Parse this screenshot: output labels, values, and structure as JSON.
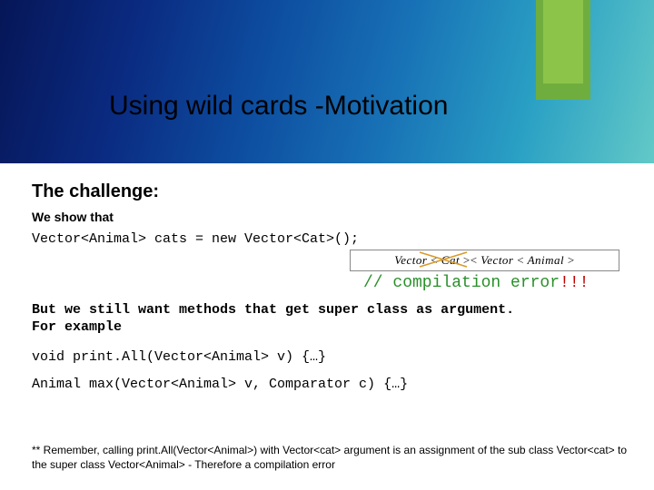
{
  "title": "Using wild cards -Motivation",
  "heading": "The challenge:",
  "subheading": "We show that",
  "code_decl": "Vector<Animal> cats = new Vector<Cat>();",
  "math_expr_html": "Vector <span class='lt'>&lt;</span> Cat <span class='lt'>&gt;</span><span class='lt'>&lt;</span> Vector <span class='lt'>&lt;</span> Animal <span class='lt'>&gt;</span>",
  "compile_comment_prefix": "// ",
  "compile_text": "compilation error",
  "compile_excl": "!!!",
  "but_line_1": "But we still want methods that get super class as argument.",
  "but_line_2": "For example",
  "method1": "void print.All(Vector<Animal> v) {…}",
  "method2": "Animal max(Vector<Animal> v, Comparator c) {…}",
  "footnote": "** Remember, calling print.All(Vector<Animal>) with Vector<cat> argument  is an assignment of the sub class Vector<cat> to the super class Vector<Animal> - Therefore a compilation error"
}
